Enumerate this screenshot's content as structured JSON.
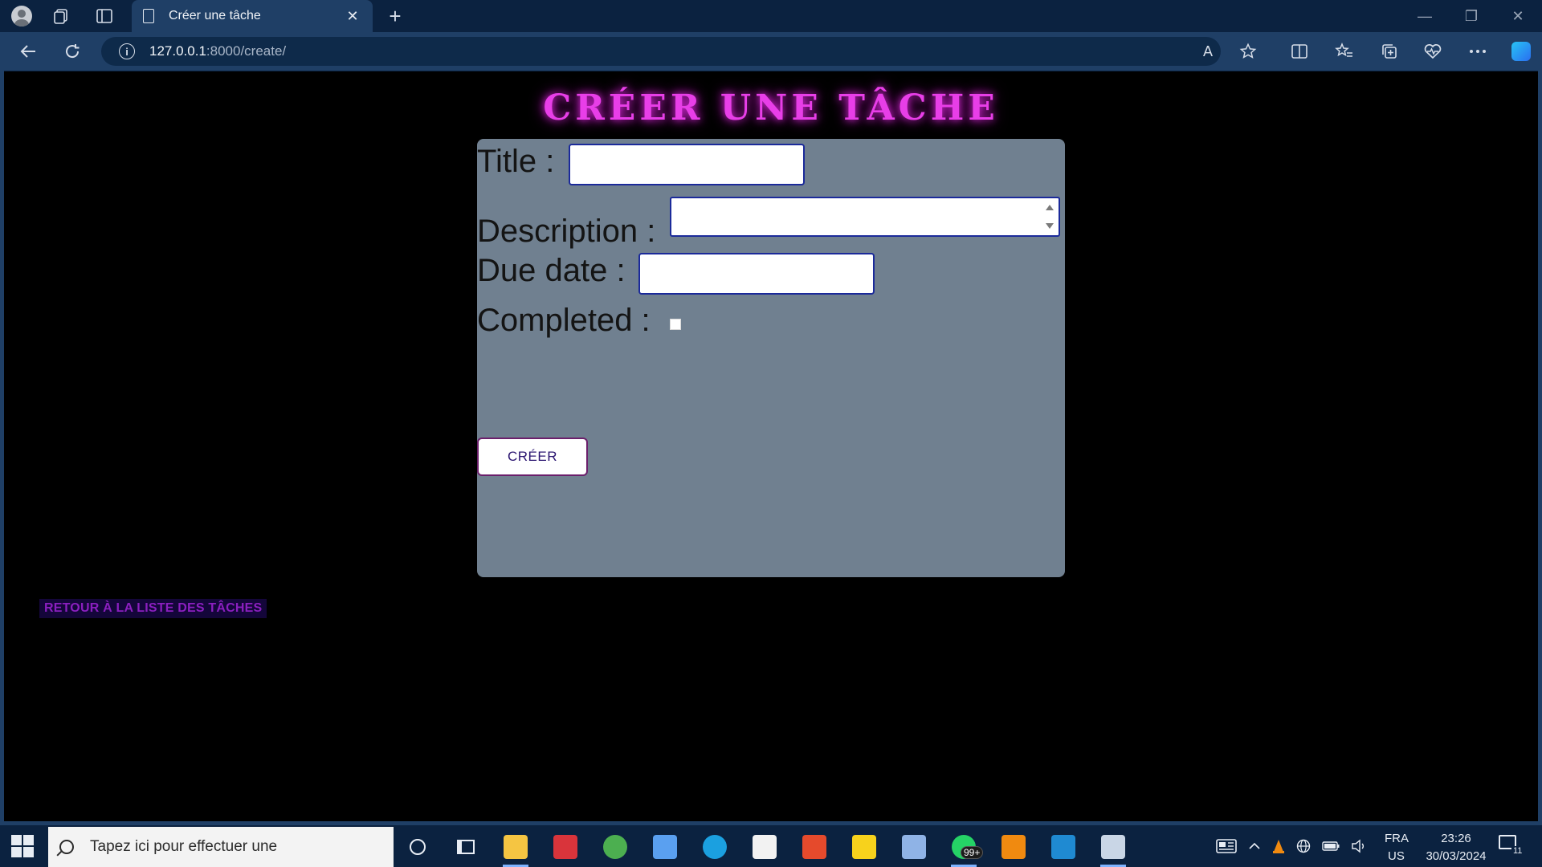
{
  "browser": {
    "tab_title": "Créer une tâche",
    "tab_close": "✕",
    "new_tab": "+",
    "url_host": "127.0.0.1",
    "url_path": ":8000/create/",
    "read_aloud": "A",
    "window_min": "—",
    "window_max": "❐",
    "window_close": "✕"
  },
  "page": {
    "title": "CRÉER UNE TÂCHE",
    "form": {
      "title_label": "Title :",
      "title_value": "",
      "description_label": "Description :",
      "description_value": "",
      "due_date_label": "Due date :",
      "due_date_value": "",
      "completed_label": "Completed :",
      "completed_checked": false,
      "submit_label": "CRÉER"
    },
    "back_link": "RETOUR À LA LISTE DES TÂCHES"
  },
  "taskbar": {
    "search_placeholder": "Tapez ici pour effectuer une",
    "whatsapp_badge": "99+",
    "lang_line1": "FRA",
    "lang_line2": "US",
    "time": "23:26",
    "date": "30/03/2024",
    "notification_count": "11",
    "apps": [
      {
        "name": "file-explorer",
        "color": "#f5c542"
      },
      {
        "name": "sliksvn",
        "color": "#d9343b"
      },
      {
        "name": "chrome",
        "color": "#4caf50"
      },
      {
        "name": "microsoft-store",
        "color": "#5aa0f0"
      },
      {
        "name": "edge",
        "color": "#1ba0e0"
      },
      {
        "name": "mail",
        "color": "#f2f2f2"
      },
      {
        "name": "office",
        "color": "#e54a2c"
      },
      {
        "name": "kmplayer",
        "color": "#f7d21c"
      },
      {
        "name": "remote-desktop",
        "color": "#8fb3e6"
      },
      {
        "name": "whatsapp",
        "color": "#25d366"
      },
      {
        "name": "vlc",
        "color": "#f08a10"
      },
      {
        "name": "vscode",
        "color": "#1f8ad2"
      },
      {
        "name": "edge-dev",
        "color": "#c9d6e6"
      }
    ]
  },
  "colors": {
    "title_glow": "#e83ee8",
    "card_bg": "#708090",
    "back_link": "#8b1fbf",
    "page_bg": "#000000"
  }
}
